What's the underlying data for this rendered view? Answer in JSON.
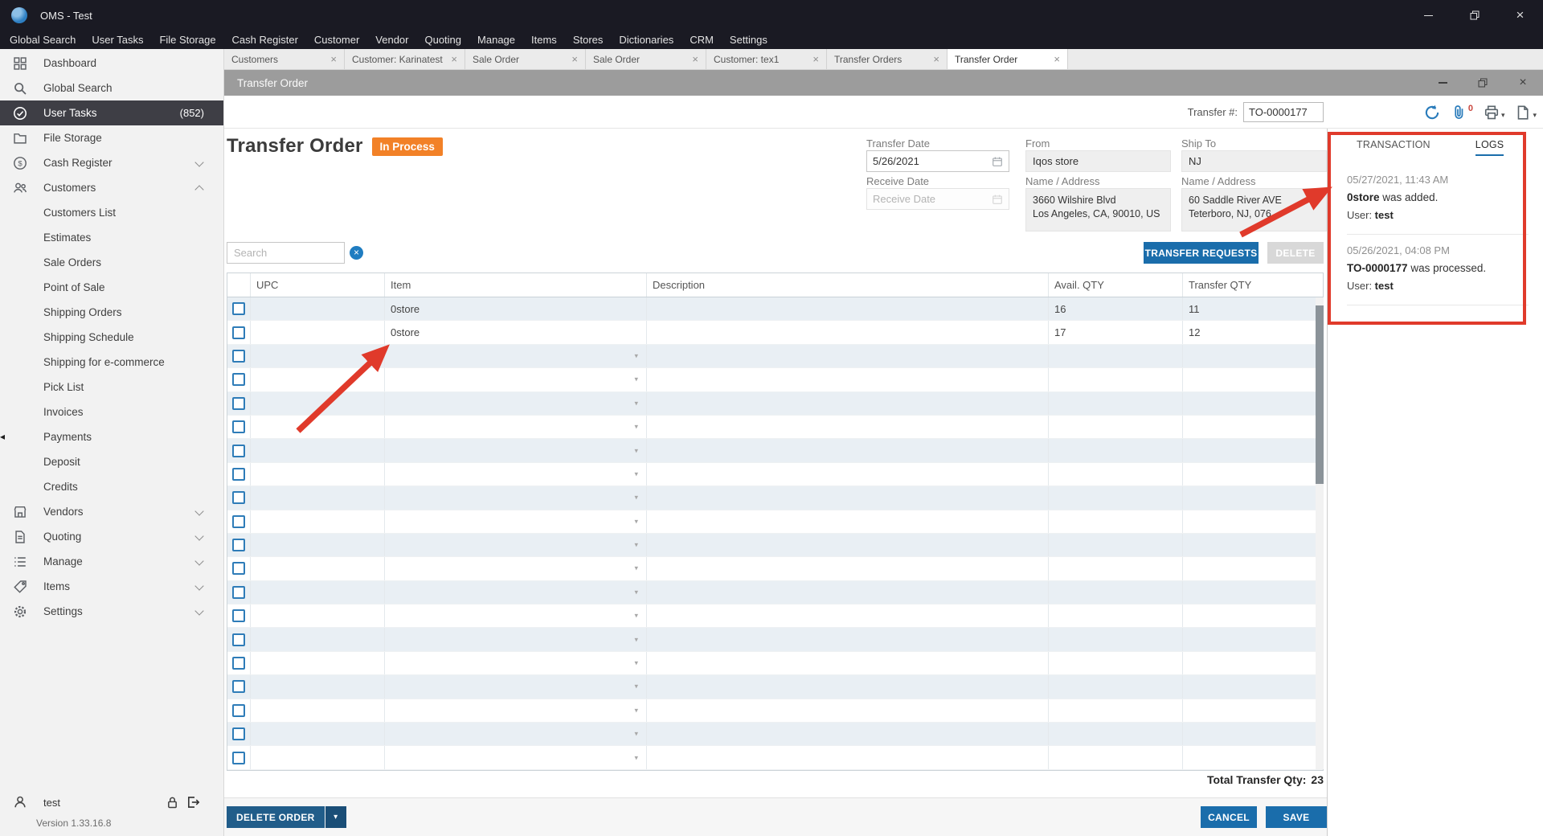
{
  "window": {
    "title": "OMS - Test"
  },
  "menubar": {
    "items": [
      "Global Search",
      "User Tasks",
      "File Storage",
      "Cash Register",
      "Customer",
      "Vendor",
      "Quoting",
      "Manage",
      "Items",
      "Stores",
      "Dictionaries",
      "CRM",
      "Settings"
    ]
  },
  "sidebar": {
    "items": [
      {
        "label": "Dashboard",
        "icon": "dashboard-icon"
      },
      {
        "label": "Global Search",
        "icon": "search-icon"
      },
      {
        "label": "User Tasks",
        "icon": "tasks-icon",
        "badge": "(852)",
        "selected": true
      },
      {
        "label": "File Storage",
        "icon": "folder-icon"
      },
      {
        "label": "Cash Register",
        "icon": "cash-icon",
        "chevron": "down"
      },
      {
        "label": "Customers",
        "icon": "people-icon",
        "chevron": "up"
      },
      {
        "label": "Customers List",
        "indent": true
      },
      {
        "label": "Estimates",
        "indent": true
      },
      {
        "label": "Sale Orders",
        "indent": true
      },
      {
        "label": "Point of Sale",
        "indent": true
      },
      {
        "label": "Shipping Orders",
        "indent": true
      },
      {
        "label": "Shipping Schedule",
        "indent": true
      },
      {
        "label": "Shipping for e-commerce",
        "indent": true
      },
      {
        "label": "Pick List",
        "indent": true
      },
      {
        "label": "Invoices",
        "indent": true
      },
      {
        "label": "Payments",
        "indent": true
      },
      {
        "label": "Deposit",
        "indent": true
      },
      {
        "label": "Credits",
        "indent": true
      },
      {
        "label": "Vendors",
        "icon": "vendors-icon",
        "chevron": "down"
      },
      {
        "label": "Quoting",
        "icon": "quoting-icon",
        "chevron": "down"
      },
      {
        "label": "Manage",
        "icon": "manage-icon",
        "chevron": "down"
      },
      {
        "label": "Items",
        "icon": "items-icon",
        "chevron": "down"
      },
      {
        "label": "Settings",
        "icon": "settings-icon",
        "chevron": "down"
      }
    ],
    "user": {
      "name": "test"
    },
    "version": "Version 1.33.16.8"
  },
  "tabs": [
    {
      "label": "Customers"
    },
    {
      "label": "Customer: Karinatest"
    },
    {
      "label": "Sale Order"
    },
    {
      "label": "Sale Order"
    },
    {
      "label": "Customer: tex1"
    },
    {
      "label": "Transfer Orders"
    },
    {
      "label": "Transfer Order",
      "active": true
    }
  ],
  "inner_window": {
    "title": "Transfer Order"
  },
  "toolbar": {
    "transfer_number_label": "Transfer #:",
    "transfer_number": "TO-0000177",
    "attachment_count": "0"
  },
  "order": {
    "heading": "Transfer Order",
    "status_badge": "In Process",
    "fields": {
      "transfer_date_label": "Transfer Date",
      "transfer_date": "5/26/2021",
      "receive_date_label": "Receive Date",
      "receive_date_placeholder": "Receive Date",
      "from_label": "From",
      "from_store": "Iqos store",
      "from_address_label": "Name / Address",
      "from_address_line1": "3660 Wilshire Blvd",
      "from_address_line2": "Los Angeles, CA, 90010, US",
      "ship_to_label": "Ship To",
      "ship_to_store": "NJ",
      "ship_to_address_label": "Name / Address",
      "ship_to_address_line1": "60 Saddle River AVE",
      "ship_to_address_line2": "Teterboro, NJ, 076"
    },
    "search_placeholder": "Search",
    "buttons": {
      "transfer_requests": "TRANSFER REQUESTS",
      "delete": "DELETE"
    }
  },
  "table": {
    "columns": [
      "UPC",
      "Item",
      "Description",
      "Avail. QTY",
      "Transfer QTY"
    ],
    "rows": [
      {
        "upc": "",
        "item": "0store",
        "description": "",
        "avail_qty": "16",
        "transfer_qty": "11"
      },
      {
        "upc": "",
        "item": "0store",
        "description": "",
        "avail_qty": "17",
        "transfer_qty": "12"
      }
    ],
    "empty_rows": 18
  },
  "summary": {
    "total_label": "Total Transfer Qty:",
    "total_value": "23"
  },
  "footer_buttons": {
    "delete_order": "DELETE ORDER",
    "cancel": "CANCEL",
    "save": "SAVE"
  },
  "log_panel": {
    "tabs": [
      {
        "label": "TRANSACTION"
      },
      {
        "label": "LOGS",
        "active": true
      }
    ],
    "entries": [
      {
        "timestamp": "05/27/2021, 11:43 AM",
        "subject": "0store",
        "message": " was added.",
        "user_label": "User:",
        "user": "test"
      },
      {
        "timestamp": "05/26/2021, 04:08 PM",
        "subject": "TO-0000177",
        "message": " was processed.",
        "user_label": "User:",
        "user": "test"
      }
    ]
  },
  "colors": {
    "accent_blue": "#1a6dab",
    "status_orange": "#f28127",
    "annotation_red": "#e03a2b",
    "dark_bar": "#1a1a23"
  }
}
